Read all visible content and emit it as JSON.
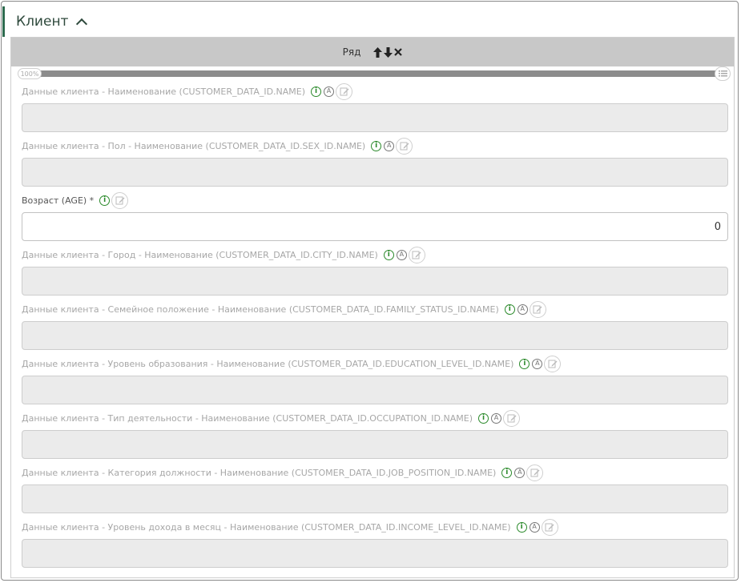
{
  "panel": {
    "title": "Клиент"
  },
  "row_bar": {
    "label": "Ряд"
  },
  "slider": {
    "percent_label": "100%",
    "value": 1.0
  },
  "icons": {
    "info": "i",
    "auto": "A"
  },
  "colors": {
    "accent": "#2e6b4f",
    "info_green": "#2b8a2b",
    "disabled_bg": "#ebebeb"
  },
  "fields": [
    {
      "label": "Данные клиента - Наименование (CUSTOMER_DATA_ID.NAME)",
      "value": "",
      "editable": false
    },
    {
      "label": "Данные клиента - Пол - Наименование (CUSTOMER_DATA_ID.SEX_ID.NAME)",
      "value": "",
      "editable": false
    },
    {
      "label": "Возраст (AGE) *",
      "value": "0",
      "editable": true
    },
    {
      "label": "Данные клиента - Город - Наименование (CUSTOMER_DATA_ID.CITY_ID.NAME)",
      "value": "",
      "editable": false
    },
    {
      "label": "Данные клиента - Семейное положение - Наименование (CUSTOMER_DATA_ID.FAMILY_STATUS_ID.NAME)",
      "value": "",
      "editable": false
    },
    {
      "label": "Данные клиента - Уровень образования - Наименование (CUSTOMER_DATA_ID.EDUCATION_LEVEL_ID.NAME)",
      "value": "",
      "editable": false
    },
    {
      "label": "Данные клиента - Тип деятельности - Наименование (CUSTOMER_DATA_ID.OCCUPATION_ID.NAME)",
      "value": "",
      "editable": false
    },
    {
      "label": "Данные клиента - Категория должности - Наименование (CUSTOMER_DATA_ID.JOB_POSITION_ID.NAME)",
      "value": "",
      "editable": false
    },
    {
      "label": "Данные клиента - Уровень дохода в месяц - Наименование (CUSTOMER_DATA_ID.INCOME_LEVEL_ID.NAME)",
      "value": "",
      "editable": false
    }
  ]
}
